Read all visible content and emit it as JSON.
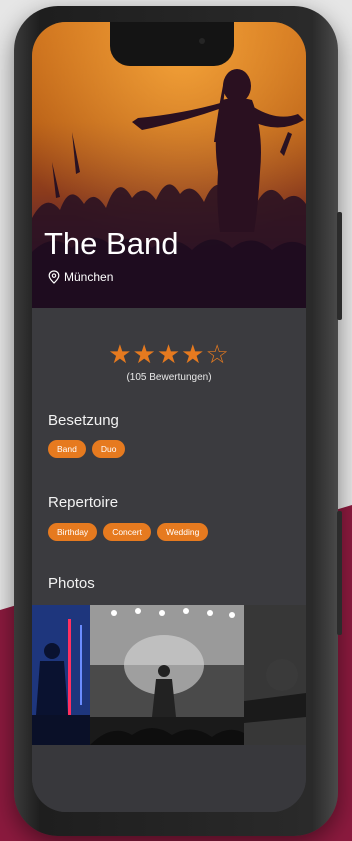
{
  "artist": {
    "name": "The Band",
    "location": "München"
  },
  "rating": {
    "stars_filled": 4,
    "stars_total": 5,
    "stars_text": "★★★★☆",
    "reviews_label": "(105 Bewertungen)"
  },
  "sections": {
    "besetzung": {
      "title": "Besetzung",
      "tags": [
        "Band",
        "Duo"
      ]
    },
    "repertoire": {
      "title": "Repertoire",
      "tags": [
        "Birthday",
        "Concert",
        "Wedding"
      ]
    },
    "photos": {
      "title": "Photos"
    }
  },
  "colors": {
    "accent": "#e67a1f",
    "screen_bg": "#3b3b3f",
    "page_bg": "#e6e6e6",
    "maroon": "#8b1a3e"
  },
  "icons": {
    "location": "map-pin-icon",
    "rating": "star-icon"
  }
}
